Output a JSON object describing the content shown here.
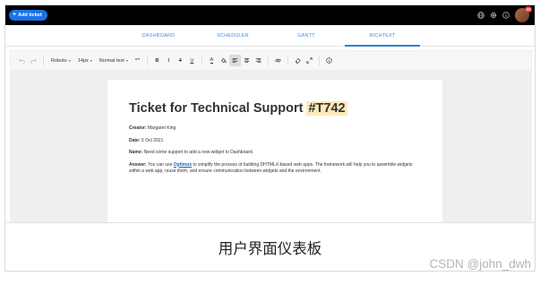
{
  "topbar": {
    "add_ticket_label": "Add ticket",
    "notification_count": "10"
  },
  "tabs": [
    {
      "label": "DASHBOARD"
    },
    {
      "label": "SCHEDULER"
    },
    {
      "label": "GANTT"
    },
    {
      "label": "RICHTEXT",
      "active": true
    }
  ],
  "toolbar": {
    "font_family": "Roboto",
    "font_size": "14px",
    "block_type": "Normal text",
    "quote_symbol": "“”",
    "bold": "B",
    "italic": "I",
    "strike": "T",
    "underline": "U",
    "text_color": "A"
  },
  "document": {
    "title": "Ticket for Technical Support",
    "title_highlight": "#T742",
    "creator_label": "Creator:",
    "creator_value": "Margaret King",
    "date_label": "Date:",
    "date_value": "5 Oct 2021",
    "name_label": "Name:",
    "name_value": "Need some support to add a new widget to Dashboard.",
    "answer_label": "Answer:",
    "answer_pre": "You can use",
    "answer_link": "Optimus",
    "answer_post": "to simplify the process of building DHTMLX-based web apps. The framework will help you to assemble widgets within a web app, reuse them, and ensure communication between widgets and the environment."
  },
  "caption": "用户界面仪表板",
  "watermark": "CSDN @john_dwh",
  "colors": {
    "accent": "#1a73e8",
    "tab_text": "#3f8de0",
    "highlight": "#fde9b8",
    "badge": "#e53935"
  }
}
